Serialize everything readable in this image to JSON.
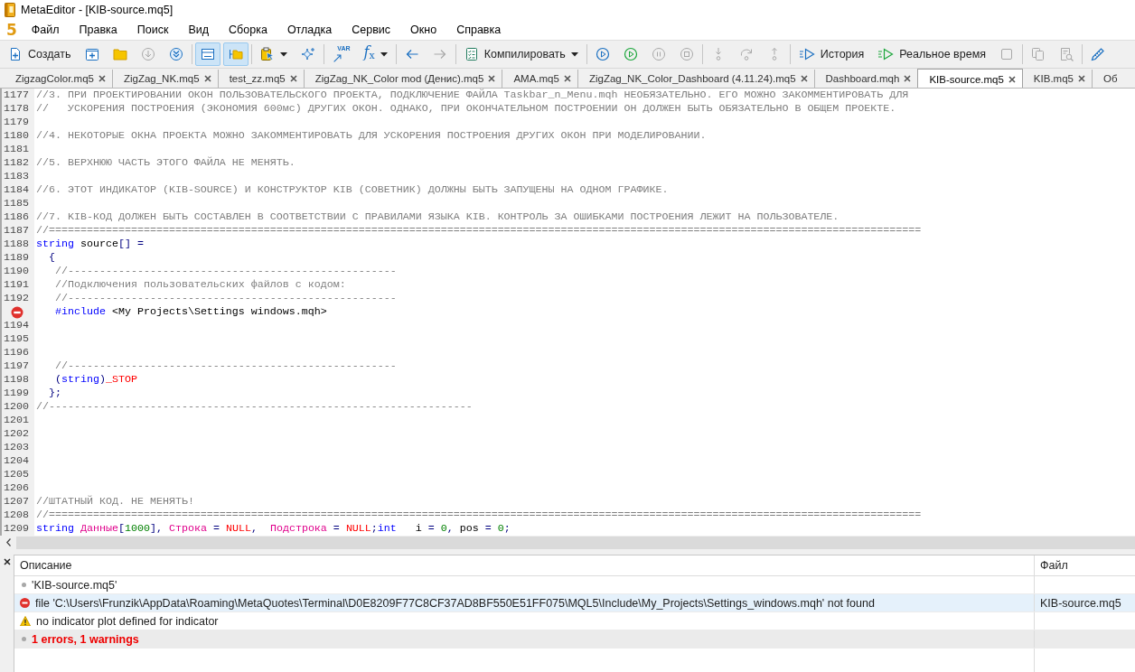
{
  "window": {
    "title": "MetaEditor - [KIB-source.mq5]"
  },
  "menu": {
    "logo": "5",
    "items": [
      "Файл",
      "Правка",
      "Поиск",
      "Вид",
      "Сборка",
      "Отладка",
      "Сервис",
      "Окно",
      "Справка"
    ]
  },
  "toolbar": [
    {
      "buttons": [
        {
          "label": "Создать",
          "disabled": false,
          "pressed": false,
          "dropdown": false
        },
        {
          "disabled": false,
          "pressed": false,
          "dropdown": false
        },
        {
          "disabled": false,
          "pressed": false,
          "dropdown": false
        },
        {
          "disabled": true,
          "pressed": false,
          "dropdown": false
        },
        {
          "disabled": false,
          "pressed": false,
          "dropdown": false
        }
      ]
    },
    {
      "buttons": [
        {
          "disabled": false,
          "pressed": true,
          "dropdown": false
        },
        {
          "disabled": false,
          "pressed": true,
          "dropdown": false
        }
      ]
    },
    {
      "buttons": [
        {
          "disabled": false,
          "pressed": false,
          "dropdown": true
        },
        {
          "disabled": false,
          "pressed": false,
          "dropdown": false
        }
      ]
    },
    {
      "buttons": [
        {
          "glyph": "VAR",
          "disabled": false,
          "pressed": false,
          "dropdown": false
        },
        {
          "glyph": "f$_{x}$",
          "disabled": false,
          "pressed": false,
          "dropdown": true
        }
      ]
    },
    {
      "buttons": [
        {
          "disabled": false,
          "pressed": false,
          "dropdown": false
        },
        {
          "disabled": true,
          "pressed": false,
          "dropdown": false
        }
      ]
    },
    {
      "buttons": [
        {
          "label": "Компилировать",
          "disabled": false,
          "pressed": false,
          "dropdown": true
        }
      ]
    },
    {
      "buttons": [
        {
          "disabled": false,
          "pressed": false,
          "dropdown": false
        },
        {
          "disabled": false,
          "pressed": false,
          "dropdown": false
        },
        {
          "disabled": true,
          "pressed": false,
          "dropdown": false
        },
        {
          "disabled": true,
          "pressed": false,
          "dropdown": false
        }
      ]
    },
    {
      "buttons": [
        {
          "disabled": true,
          "pressed": false,
          "dropdown": false
        },
        {
          "disabled": true,
          "pressed": false,
          "dropdown": false
        },
        {
          "disabled": true,
          "pressed": false,
          "dropdown": false
        }
      ]
    },
    {
      "buttons": [
        {
          "label": "История",
          "disabled": false,
          "pressed": false,
          "dropdown": false
        },
        {
          "label": "Реальное время",
          "disabled": false,
          "pressed": false,
          "dropdown": false
        },
        {
          "disabled": true,
          "pressed": false,
          "dropdown": false
        }
      ]
    },
    {
      "buttons": [
        {
          "disabled": true,
          "pressed": false,
          "dropdown": false
        },
        {
          "disabled": true,
          "pressed": false,
          "dropdown": false
        }
      ]
    },
    {
      "buttons": [
        {
          "disabled": false,
          "pressed": false,
          "dropdown": false
        }
      ]
    }
  ],
  "tabs": [
    {
      "label": "ZigzagColor.mq5",
      "selected": false,
      "closable": true
    },
    {
      "label": "ZigZag_NK.mq5",
      "selected": false,
      "closable": true
    },
    {
      "label": "test_zz.mq5",
      "selected": false,
      "closable": true
    },
    {
      "label": "ZigZag_NK_Color mod (Денис).mq5",
      "selected": false,
      "closable": true
    },
    {
      "label": "AMA.mq5",
      "selected": false,
      "closable": true
    },
    {
      "label": "ZigZag_NK_Color_Dashboard (4.11.24).mq5",
      "selected": false,
      "closable": true
    },
    {
      "label": "Dashboard.mqh",
      "selected": false,
      "closable": true
    },
    {
      "label": "KIB-source.mq5",
      "selected": true,
      "closable": true
    },
    {
      "label": "KIB.mq5",
      "selected": false,
      "closable": true
    },
    {
      "label": "Об",
      "selected": false,
      "closable": false
    }
  ],
  "editor": {
    "lines": [
      {
        "number": "1177",
        "error": false,
        "tokens": [
          {
            "kind": "comment",
            "text": "//3. ПРИ ПРОЕКТИРОВАНИИ ОКОН ПОЛЬЗОВАТЕЛЬСКОГО ПРОЕКТА, ПОДКЛЮЧЕНИЕ ФАЙЛА Taskbar_n_Menu.mqh НЕОБЯЗАТЕЛЬНО. ЕГО МОЖНО ЗАКОММЕНТИРОВАТЬ ДЛЯ"
          }
        ]
      },
      {
        "number": "1178",
        "error": false,
        "tokens": [
          {
            "kind": "comment",
            "text": "//   УСКОРЕНИЯ ПОСТРОЕНИЯ (ЭКОНОМИЯ 600мс) ДРУГИХ ОКОН. ОДНАКО, ПРИ ОКОНЧАТЕЛЬНОМ ПОСТРОЕНИИ ОН ДОЛЖЕН БЫТЬ ОБЯЗАТЕЛЬНО В ОБЩЕМ ПРОЕКТЕ."
          }
        ]
      },
      {
        "number": "1179",
        "error": false
      },
      {
        "number": "1180",
        "error": false,
        "tokens": [
          {
            "kind": "comment",
            "text": "//4. НЕКОТОРЫЕ ОКНА ПРОЕКТА МОЖНО ЗАКОММЕНТИРОВАТЬ ДЛЯ УСКОРЕНИЯ ПОСТРОЕНИЯ ДРУГИХ ОКОН ПРИ МОДЕЛИРОВАНИИ."
          }
        ]
      },
      {
        "number": "1181",
        "error": false
      },
      {
        "number": "1182",
        "error": false,
        "tokens": [
          {
            "kind": "comment",
            "text": "//5. ВЕРХНЮЮ ЧАСТЬ ЭТОГО ФАЙЛА НЕ МЕНЯТЬ."
          }
        ]
      },
      {
        "number": "1183",
        "error": false
      },
      {
        "number": "1184",
        "error": false,
        "tokens": [
          {
            "kind": "comment",
            "text": "//6. ЭТОТ ИНДИКАТОР (KIB-SOURCE) И КОНСТРУКТОР KIB (СОВЕТНИК) ДОЛЖНЫ БЫТЬ ЗАПУЩЕНЫ НА ОДНОМ ГРАФИКЕ."
          }
        ]
      },
      {
        "number": "1185",
        "error": false
      },
      {
        "number": "1186",
        "error": false,
        "tokens": [
          {
            "kind": "comment",
            "text": "//7. KIB-КОД ДОЛЖЕН БЫТЬ СОСТАВЛЕН В СООТВЕТСТВИИ С ПРАВИЛАМИ ЯЗЫКА KIB. КОНТРОЛЬ ЗА ОШИБКАМИ ПОСТРОЕНИЯ ЛЕЖИТ НА ПОЛЬЗОВАТЕЛЕ."
          }
        ]
      },
      {
        "number": "1187",
        "error": false,
        "tokens": [
          {
            "kind": "comment",
            "text": "//=========================================================================================================================================="
          }
        ]
      },
      {
        "number": "1188",
        "error": false,
        "tokens": [
          {
            "kind": "keyword",
            "text": "string"
          },
          {
            "kind": "plain",
            "text": " source"
          },
          {
            "kind": "punct",
            "text": "[] ="
          }
        ]
      },
      {
        "number": "1189",
        "error": false,
        "tokens": [
          {
            "kind": "punct",
            "text": "  {"
          }
        ]
      },
      {
        "number": "1190",
        "error": false,
        "tokens": [
          {
            "kind": "comment",
            "text": "   //----------------------------------------------------"
          }
        ]
      },
      {
        "number": "1191",
        "error": false,
        "tokens": [
          {
            "kind": "comment",
            "text": "   //Подключения пользовательских файлов с кодом:"
          }
        ]
      },
      {
        "number": "1192",
        "error": false,
        "tokens": [
          {
            "kind": "comment",
            "text": "   //----------------------------------------------------"
          }
        ]
      },
      {
        "error": true,
        "tokens": [
          {
            "kind": "preprocessor",
            "text": "   #include"
          },
          {
            "kind": "plain",
            "text": " <My Projects\\Settings windows.mqh>"
          }
        ]
      },
      {
        "number": "1194",
        "error": false
      },
      {
        "number": "1195",
        "error": false
      },
      {
        "number": "1196",
        "error": false
      },
      {
        "number": "1197",
        "error": false,
        "tokens": [
          {
            "kind": "comment",
            "text": "   //----------------------------------------------------"
          }
        ]
      },
      {
        "number": "1198",
        "error": false,
        "tokens": [
          {
            "kind": "punct",
            "text": "   ("
          },
          {
            "kind": "keyword",
            "text": "string"
          },
          {
            "kind": "punct",
            "text": ")"
          },
          {
            "kind": "macro",
            "text": "_STOP"
          }
        ]
      },
      {
        "number": "1199",
        "error": false,
        "tokens": [
          {
            "kind": "punct",
            "text": "  };"
          }
        ]
      },
      {
        "number": "1200",
        "error": false,
        "tokens": [
          {
            "kind": "comment",
            "text": "//-------------------------------------------------------------------"
          }
        ]
      },
      {
        "number": "1201",
        "error": false
      },
      {
        "number": "1202",
        "error": false
      },
      {
        "number": "1203",
        "error": false
      },
      {
        "number": "1204",
        "error": false
      },
      {
        "number": "1205",
        "error": false
      },
      {
        "number": "1206",
        "error": false
      },
      {
        "number": "1207",
        "error": false,
        "tokens": [
          {
            "kind": "comment",
            "text": "//ШТАТНЫЙ КОД. НЕ МЕНЯТЬ!"
          }
        ]
      },
      {
        "number": "1208",
        "error": false,
        "tokens": [
          {
            "kind": "comment",
            "text": "//=========================================================================================================================================="
          }
        ]
      },
      {
        "number": "1209",
        "error": false,
        "tokens": [
          {
            "kind": "keyword",
            "text": "string "
          },
          {
            "kind": "global",
            "text": "Данные"
          },
          {
            "kind": "punct",
            "text": "["
          },
          {
            "kind": "number",
            "text": "1000"
          },
          {
            "kind": "punct",
            "text": "], "
          },
          {
            "kind": "global",
            "text": "Строка"
          },
          {
            "kind": "punct",
            "text": " = "
          },
          {
            "kind": "constant",
            "text": "NULL"
          },
          {
            "kind": "punct",
            "text": ",  "
          },
          {
            "kind": "global",
            "text": "Подстрока"
          },
          {
            "kind": "punct",
            "text": " = "
          },
          {
            "kind": "constant",
            "text": "NULL"
          },
          {
            "kind": "punct",
            "text": ";"
          },
          {
            "kind": "keyword",
            "text": "int"
          },
          {
            "kind": "plain",
            "text": "   i "
          },
          {
            "kind": "punct",
            "text": "= "
          },
          {
            "kind": "number",
            "text": "0"
          },
          {
            "kind": "punct",
            "text": ", "
          },
          {
            "kind": "plain",
            "text": "pos "
          },
          {
            "kind": "punct",
            "text": "= "
          },
          {
            "kind": "number",
            "text": "0"
          },
          {
            "kind": "punct",
            "text": ";"
          }
        ]
      }
    ]
  },
  "messages": {
    "columns": [
      "Описание",
      "Файл"
    ],
    "rows": [
      {
        "kind": "info",
        "text": "'KIB-source.mq5'",
        "selected": false
      },
      {
        "kind": "error",
        "text": "file 'C:\\Users\\Frunzik\\AppData\\Roaming\\MetaQuotes\\Terminal\\D0E8209F77C8CF37AD8BF550E51FF075\\MQL5\\Include\\My_Projects\\Settings_windows.mqh' not found",
        "file": "KIB-source.mq5",
        "selected": true
      },
      {
        "kind": "warning",
        "text": "no indicator plot defined for indicator",
        "selected": false
      },
      {
        "kind": "summary",
        "text": "1 errors, 1 warnings",
        "selected": false
      }
    ]
  }
}
